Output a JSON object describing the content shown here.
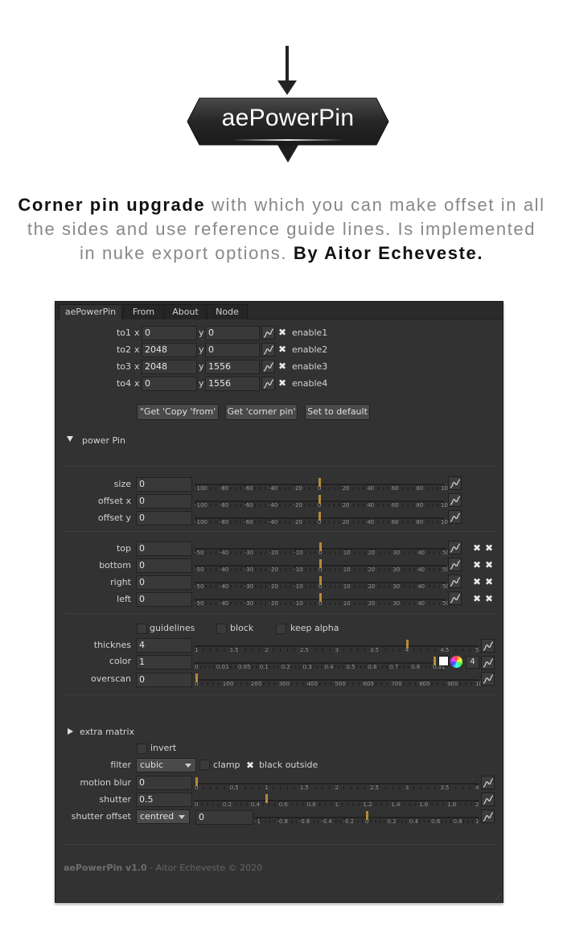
{
  "banner": {
    "title": "aePowerPin"
  },
  "description": {
    "lead": "Corner pin upgrade",
    "text": "with which you can make offset in all the sides and use reference guide lines. Is implemented in nuke export options.",
    "author": "By Aitor Echeveste."
  },
  "tabs": [
    "aePowerPin",
    "From",
    "About",
    "Node"
  ],
  "corners": [
    {
      "label": "to1",
      "x": "0",
      "y": "0",
      "enable": "enable1"
    },
    {
      "label": "to2",
      "x": "2048",
      "y": "0",
      "enable": "enable2"
    },
    {
      "label": "to3",
      "x": "2048",
      "y": "1556",
      "enable": "enable3"
    },
    {
      "label": "to4",
      "x": "0",
      "y": "1556",
      "enable": "enable4"
    }
  ],
  "xy": {
    "x": "x",
    "y": "y"
  },
  "buttons": {
    "copy_from": "\"Get 'Copy 'from'",
    "corner_pin": "Get 'corner pin'",
    "default": "Set to default"
  },
  "power_pin": {
    "label": "power Pin"
  },
  "size_group": [
    {
      "label": "size",
      "value": "0"
    },
    {
      "label": "offset x",
      "value": "0"
    },
    {
      "label": "offset y",
      "value": "0"
    }
  ],
  "size_ticks": [
    "-100",
    "-80",
    "-60",
    "-40",
    "-20",
    "0",
    "20",
    "40",
    "60",
    "80",
    "100"
  ],
  "edge_group": [
    {
      "label": "top",
      "value": "0"
    },
    {
      "label": "bottom",
      "value": "0"
    },
    {
      "label": "right",
      "value": "0"
    },
    {
      "label": "left",
      "value": "0"
    }
  ],
  "edge_ticks": [
    "-50",
    "-40",
    "-30",
    "-20",
    "-10",
    "0",
    "10",
    "20",
    "30",
    "40",
    "50"
  ],
  "guides": {
    "guidelines": "guidelines",
    "block": "block",
    "keep_alpha": "keep alpha"
  },
  "thicknes": {
    "label": "thicknes",
    "value": "4",
    "ticks": [
      "1",
      "1.5",
      "2",
      "2.5",
      "3",
      "3.5",
      "4",
      "4.5",
      "5"
    ],
    "level": 4
  },
  "color": {
    "label": "color",
    "value": "1",
    "ticks": [
      "0",
      "0.01",
      "0.05",
      "0.1",
      "0.2",
      "0.3",
      "0.4",
      "0.5",
      "0.6",
      "0.7",
      "0.8",
      "0.91"
    ],
    "channels": "4"
  },
  "overscan": {
    "label": "overscan",
    "value": "0",
    "ticks": [
      "0",
      "100",
      "200",
      "300",
      "400",
      "500",
      "600",
      "700",
      "800",
      "900",
      "1024"
    ]
  },
  "extra_matrix": {
    "label": "extra matrix",
    "invert": "invert"
  },
  "filter": {
    "label": "filter",
    "value": "cubic",
    "clamp": "clamp",
    "black_outside": "black outside"
  },
  "motion_blur": {
    "label": "motion blur",
    "value": "0",
    "ticks": [
      "0",
      "0.5",
      "1",
      "1.5",
      "2",
      "2.5",
      "3",
      "3.5",
      "4"
    ]
  },
  "shutter": {
    "label": "shutter",
    "value": "0.5",
    "ticks": [
      "0",
      "0.2",
      "0.4",
      "0.6",
      "0.8",
      "1",
      "1.2",
      "1.4",
      "1.6",
      "1.8",
      "2"
    ]
  },
  "shutter_offset": {
    "label": "shutter offset",
    "mode": "centred",
    "value": "0",
    "ticks": [
      "-1",
      "-0.8",
      "-0.6",
      "-0.4",
      "-0.2",
      "0",
      "0.2",
      "0.4",
      "0.6",
      "0.8",
      "1"
    ]
  },
  "footer": {
    "name": "aePowerPin v1.0",
    "credit": "- Aitor Echeveste © 2020"
  },
  "colors": {
    "panel": "#323232",
    "field": "#393939",
    "handle": "#b58a3a"
  }
}
